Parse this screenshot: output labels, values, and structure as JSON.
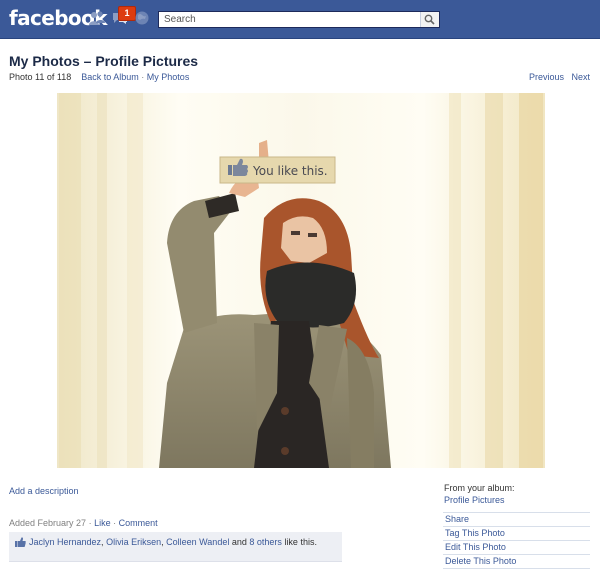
{
  "header": {
    "logo": "facebook",
    "notification_count": "1",
    "search_placeholder": "Search"
  },
  "page": {
    "title": "My Photos – Profile Pictures",
    "photo_counter": "Photo 11 of 118",
    "back_to_album": "Back to Album",
    "separator": "·",
    "my_photos": "My Photos",
    "previous": "Previous",
    "next": "Next"
  },
  "photo": {
    "sign_text": "You like this."
  },
  "details": {
    "add_description": "Add a description",
    "added": "Added February 27",
    "dot": "·",
    "like": "Like",
    "comment": "Comment",
    "likers": [
      "Jaclyn Hernandez",
      "Olivia Eriksen",
      "Colleen Wandel"
    ],
    "comma": ",",
    "and_text": "and",
    "others": "8 others",
    "like_this": "like this."
  },
  "sidebar": {
    "from_album": "From your album:",
    "album_name": "Profile Pictures",
    "actions": [
      "Share",
      "Tag This Photo",
      "Edit This Photo",
      "Delete This Photo"
    ]
  },
  "colors": {
    "brand_blue": "#3b5998",
    "link": "#3b5998",
    "like_box": "#edeff4",
    "badge_red": "#dd3c10"
  }
}
